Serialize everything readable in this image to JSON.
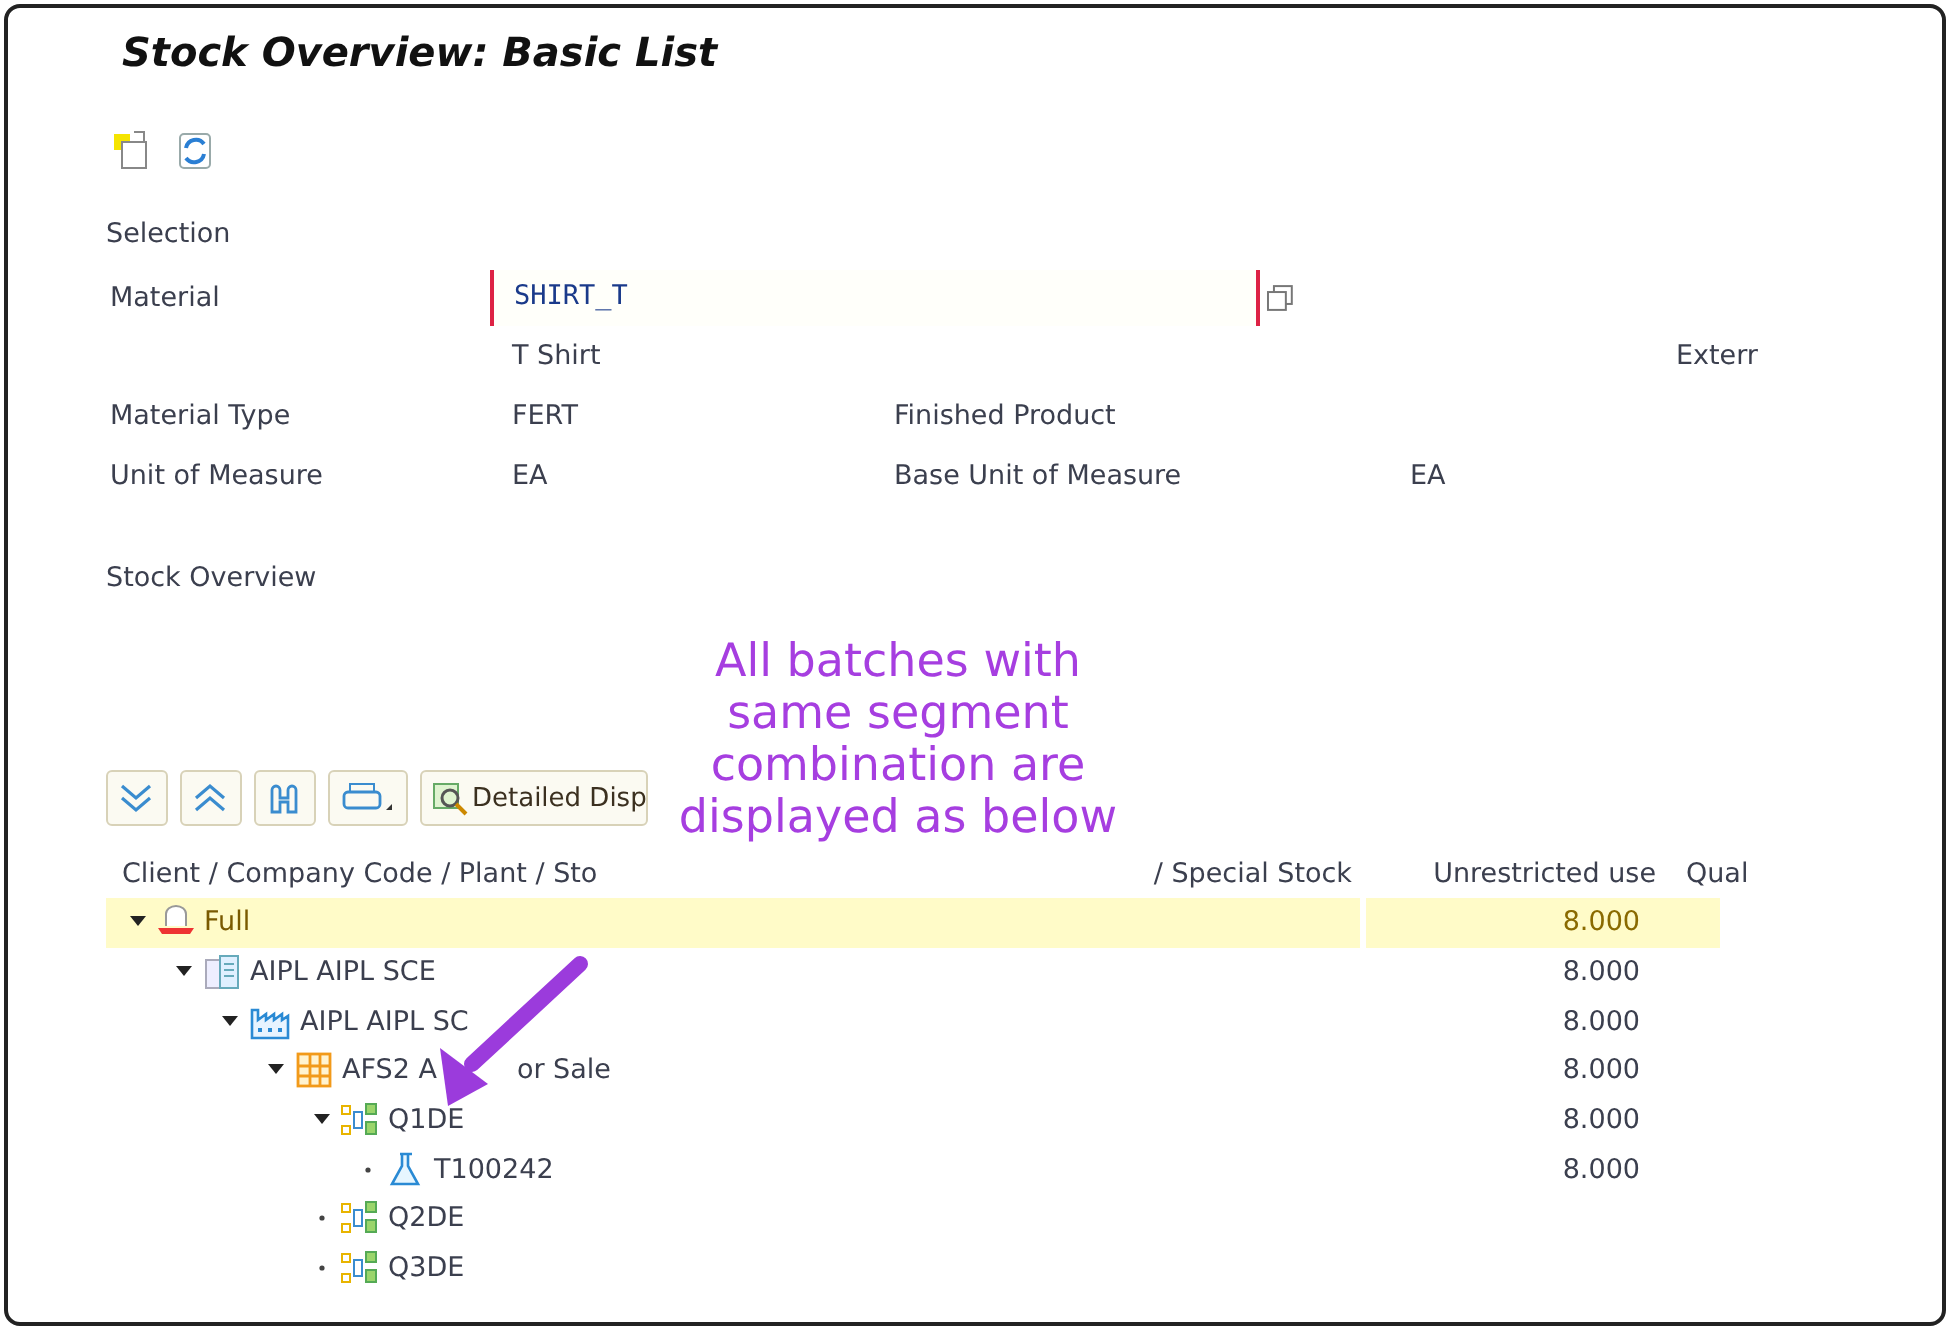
{
  "title": "Stock Overview: Basic List",
  "selection": {
    "heading": "Selection",
    "material": {
      "label": "Material",
      "value": "SHIRT_T",
      "description": "T Shirt",
      "extra": "Exterr"
    },
    "rows": [
      {
        "label": "Material Type",
        "value": "FERT",
        "text": "Finished Product"
      },
      {
        "label": "Unit of Measure",
        "value": "EA",
        "text": "Base Unit of Measure",
        "text_value": "EA"
      }
    ]
  },
  "stock_heading": "Stock Overview",
  "toolbar": {
    "detail_button": "Detailed Disp"
  },
  "columns": {
    "tree_start": "Client / Company Code / Plant / Sto",
    "tree_end": "/ Special Stock",
    "unrestricted": "Unrestricted use",
    "quality": "Qual"
  },
  "tree": [
    {
      "kind": "client",
      "label": "Full",
      "amount": "8.000",
      "selected": true,
      "expanded": true,
      "children": [
        {
          "kind": "company",
          "label": "AIPL AIPL SCE",
          "amount": "8.000",
          "selected": false,
          "expanded": true,
          "children": [
            {
              "kind": "plant",
              "label": "AIPL AIPL SC",
              "amount": "8.000",
              "selected": false,
              "expanded": true,
              "children": [
                {
                  "kind": "storage",
                  "label": "AFS2 A",
                  "label_after": "or Sale",
                  "amount": "8.000",
                  "selected": false,
                  "expanded": true,
                  "children": [
                    {
                      "kind": "segment",
                      "label": "Q1DE",
                      "amount": "8.000",
                      "selected": false,
                      "expanded": true,
                      "children": [
                        {
                          "kind": "batch",
                          "label": "T100242",
                          "amount": "8.000",
                          "selected": false,
                          "expanded": false
                        }
                      ]
                    },
                    {
                      "kind": "segment",
                      "label": "Q2DE",
                      "selected": false,
                      "expanded": false
                    },
                    {
                      "kind": "segment",
                      "label": "Q3DE",
                      "selected": false,
                      "expanded": false
                    }
                  ]
                }
              ]
            }
          ]
        }
      ]
    }
  ],
  "annotation": {
    "lines": [
      "All batches with",
      "same segment",
      "combination are",
      "displayed as below"
    ]
  }
}
